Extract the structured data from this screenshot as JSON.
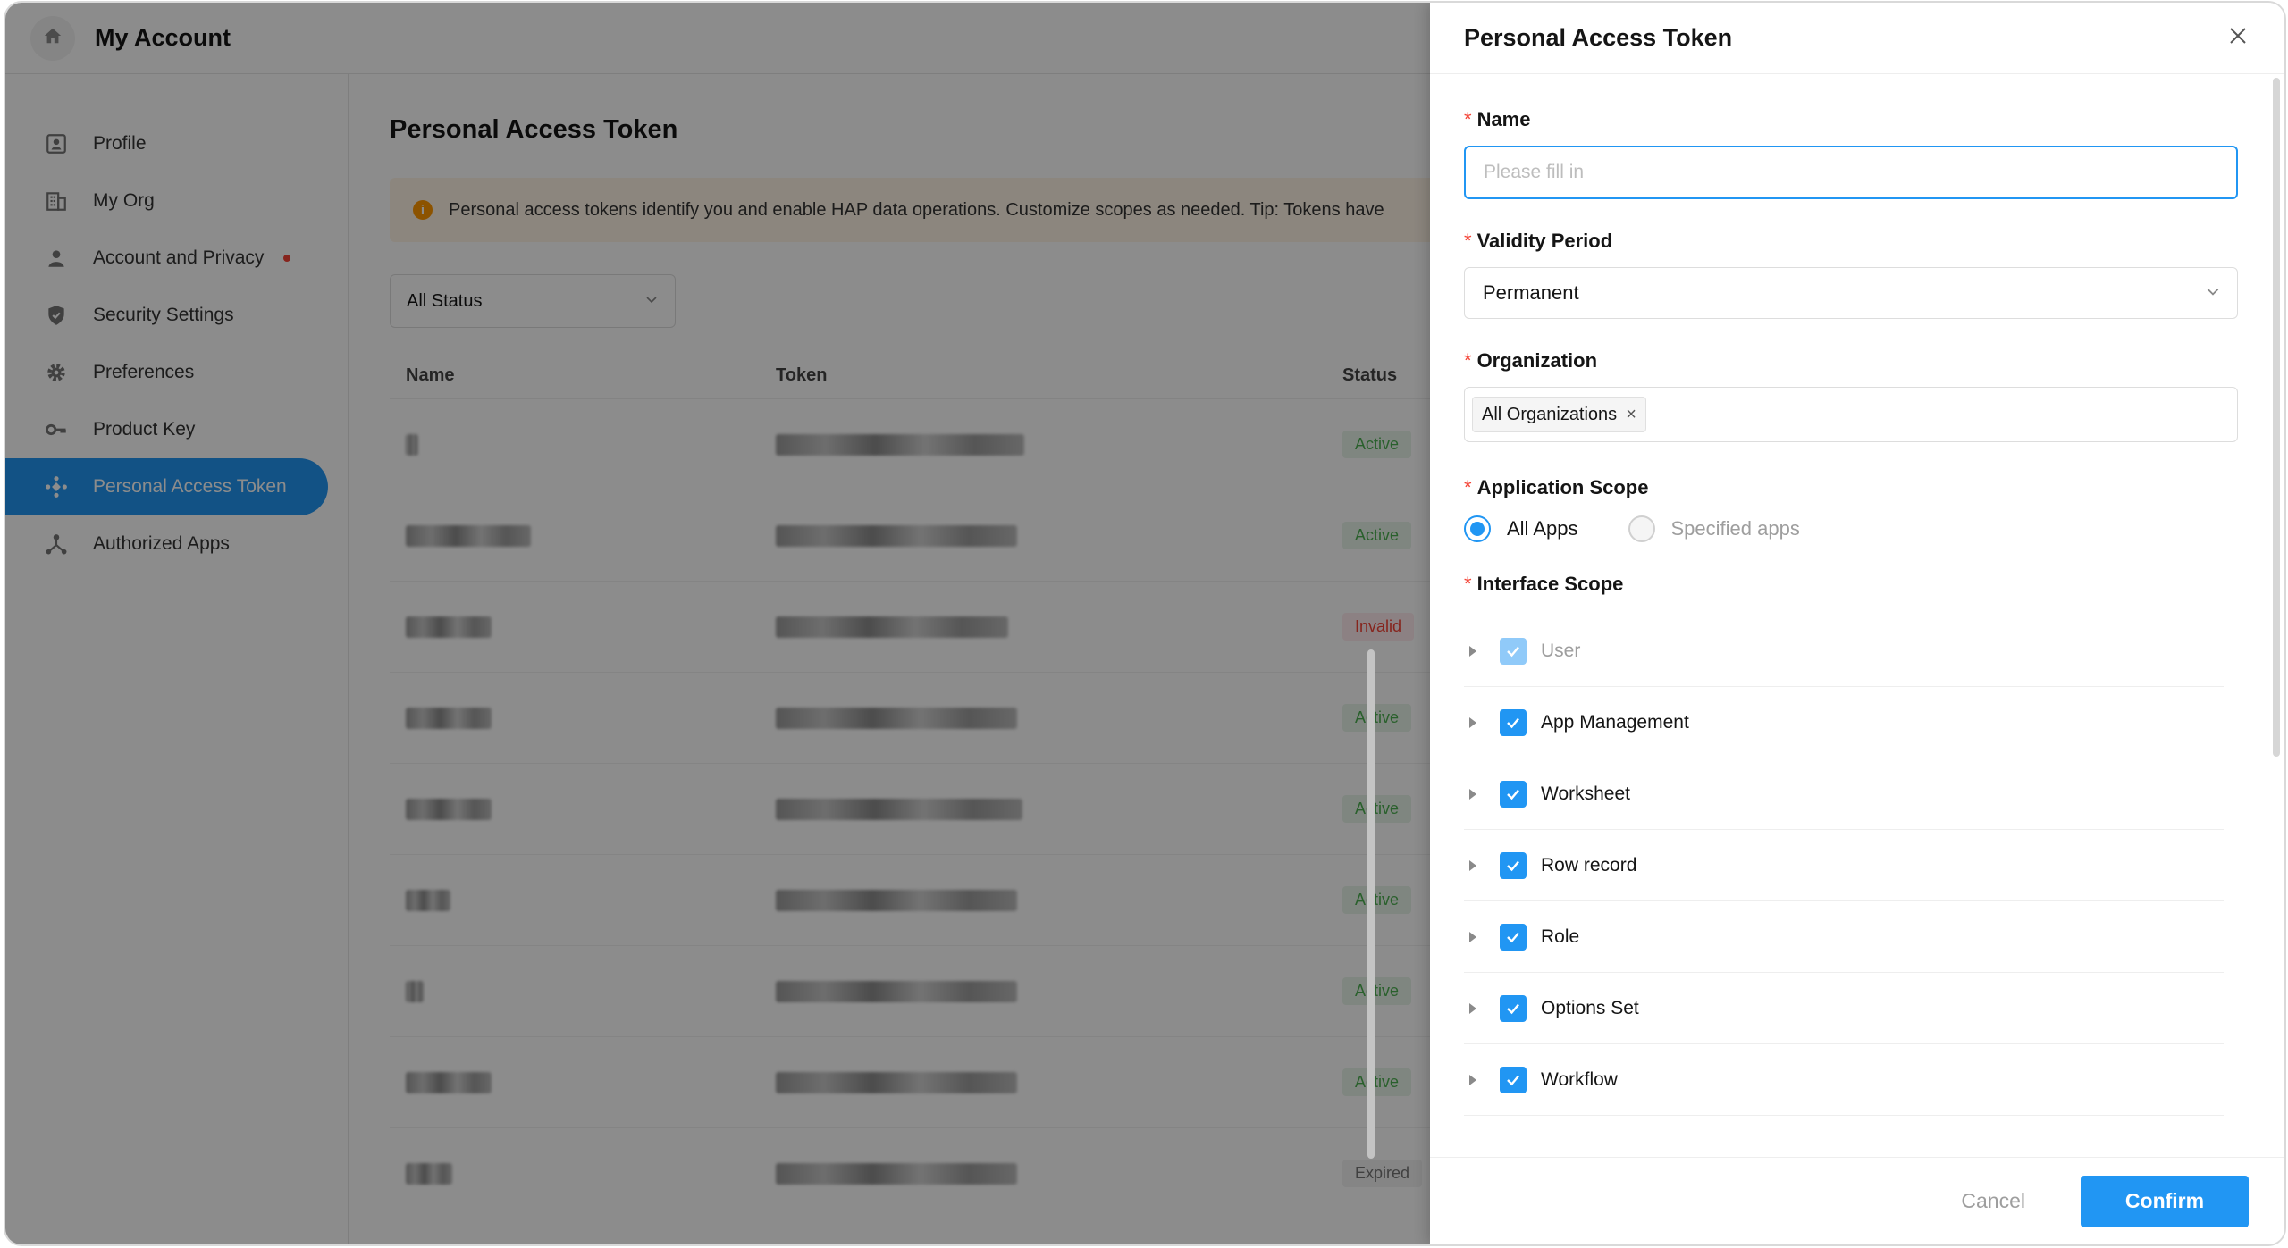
{
  "topbar": {
    "title": "My Account",
    "home_icon": "home-icon"
  },
  "sidebar": {
    "items": [
      {
        "label": "Profile",
        "icon": "profile-icon"
      },
      {
        "label": "My Org",
        "icon": "building-icon"
      },
      {
        "label": "Account and Privacy",
        "icon": "person-icon",
        "has_dot": true
      },
      {
        "label": "Security Settings",
        "icon": "shield-icon"
      },
      {
        "label": "Preferences",
        "icon": "gear-icon"
      },
      {
        "label": "Product Key",
        "icon": "key-icon"
      },
      {
        "label": "Personal Access Token",
        "icon": "token-icon",
        "active": true
      },
      {
        "label": "Authorized Apps",
        "icon": "apps-icon"
      }
    ]
  },
  "main": {
    "title": "Personal Access Token",
    "alert_text": "Personal access tokens identify you and enable HAP data operations. Customize scopes as needed. Tip: Tokens have",
    "status_filter": "All Status",
    "columns": {
      "name": "Name",
      "token": "Token",
      "status": "Status"
    },
    "rows": [
      {
        "status": "Active",
        "kind": "active"
      },
      {
        "status": "Active",
        "kind": "active"
      },
      {
        "status": "Invalid",
        "kind": "invalid"
      },
      {
        "status": "Active",
        "kind": "active"
      },
      {
        "status": "Active",
        "kind": "active"
      },
      {
        "status": "Active",
        "kind": "active"
      },
      {
        "status": "Active",
        "kind": "active"
      },
      {
        "status": "Active",
        "kind": "active"
      },
      {
        "status": "Expired",
        "kind": "expired"
      }
    ]
  },
  "drawer": {
    "title": "Personal Access Token",
    "name_label": "Name",
    "name_placeholder": "Please fill in",
    "validity_label": "Validity Period",
    "validity_value": "Permanent",
    "organization_label": "Organization",
    "organization_tag": "All Organizations",
    "app_scope_label": "Application Scope",
    "app_scope_options": [
      {
        "label": "All Apps",
        "checked": true
      },
      {
        "label": "Specified apps",
        "checked": false
      }
    ],
    "interface_scope_label": "Interface Scope",
    "interface_scopes": [
      {
        "label": "User",
        "checked": true,
        "disabled": true
      },
      {
        "label": "App Management",
        "checked": true,
        "disabled": false
      },
      {
        "label": "Worksheet",
        "checked": true,
        "disabled": false
      },
      {
        "label": "Row record",
        "checked": true,
        "disabled": false
      },
      {
        "label": "Role",
        "checked": true,
        "disabled": false
      },
      {
        "label": "Options Set",
        "checked": true,
        "disabled": false
      },
      {
        "label": "Workflow",
        "checked": true,
        "disabled": false
      }
    ],
    "cancel_label": "Cancel",
    "confirm_label": "Confirm"
  },
  "colors": {
    "accent": "#2196f3",
    "active_status": "#4caf50",
    "invalid_status": "#f44336",
    "required_mark": "#f44336",
    "alert_bg": "#fff5e6"
  }
}
